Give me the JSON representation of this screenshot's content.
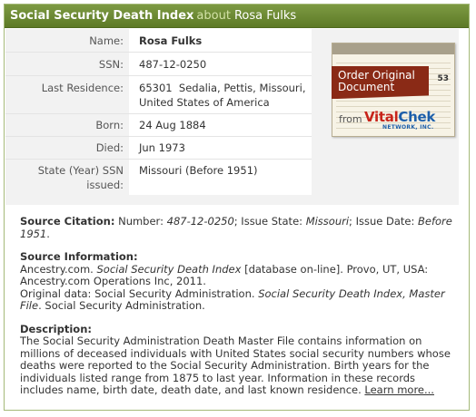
{
  "header": {
    "title": "Social Security Death Index",
    "about": "about",
    "person": "Rosa Fulks"
  },
  "fields": {
    "name_label": "Name:",
    "name_value": "Rosa Fulks",
    "ssn_label": "SSN:",
    "ssn_value": "487-12-0250",
    "residence_label": "Last Residence:",
    "residence_value_1": "65301  Sedalia, Pettis, Missouri,",
    "residence_value_2": "United States of America",
    "born_label": "Born:",
    "born_value": "24 Aug 1884",
    "died_label": "Died:",
    "died_value": "Jun 1973",
    "state_label_1": "State (Year) SSN",
    "state_label_2": "issued:",
    "state_value": "Missouri (Before 1951)"
  },
  "order_button": {
    "line1": "Order Original",
    "line2": "Document",
    "from": "from",
    "brand_part1": "Vital",
    "brand_part2": "Chek",
    "network": "NETWORK, INC.",
    "stamp": "53"
  },
  "citation": {
    "label": "Source Citation:",
    "number_label": "Number:",
    "number": "487-12-0250",
    "issue_state_label": "; Issue State:",
    "issue_state": "Missouri",
    "issue_date_label": "; Issue Date:",
    "issue_date": "Before 1951",
    "end": "."
  },
  "source_info": {
    "label": "Source Information:",
    "line1_a": "Ancestry.com.",
    "line1_title": "Social Security Death Index",
    "line1_b": "[database on-line]. Provo, UT, USA:",
    "line2": "Ancestry.com Operations Inc, 2011.",
    "line3_a": "Original data: Social Security Administration.",
    "line3_title": "Social Security Death Index, Master File",
    "line3_b": ". Social Security Administration."
  },
  "description": {
    "label": "Description:",
    "text": "The Social Security Administration Death Master File contains information on millions of deceased individuals with United States social security numbers whose deaths were reported to the Social Security Administration. Birth years for the individuals listed range from 1875 to last year. Information in these records includes name, birth date, death date, and last known residence.",
    "link": "Learn more..."
  }
}
